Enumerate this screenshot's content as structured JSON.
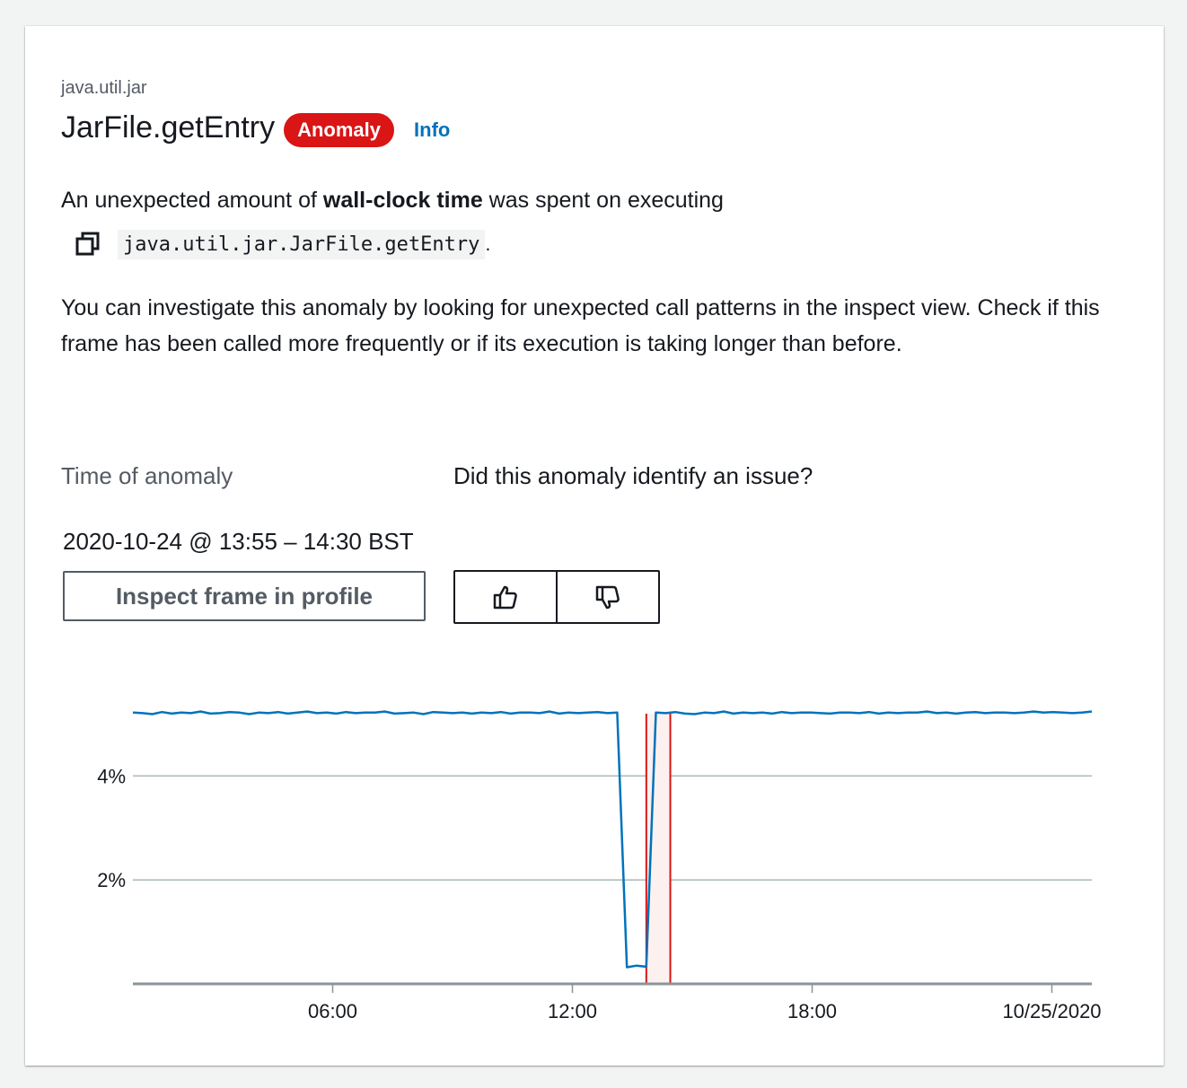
{
  "header": {
    "package": "java.util.jar",
    "title": "JarFile.getEntry",
    "badge": "Anomaly",
    "info_link": "Info"
  },
  "description": {
    "prefix": "An unexpected amount of ",
    "bold": "wall-clock time",
    "suffix": " was spent on executing",
    "code": "java.util.jar.JarFile.getEntry",
    "code_suffix": ".",
    "copy_icon": "copy-icon"
  },
  "guidance": "You can investigate this anomaly by looking for unexpected call patterns in the inspect view. Check if this frame has been called more frequently or if its execution is taking longer than before.",
  "time_of_anomaly": {
    "label": "Time of anomaly",
    "value": "2020-10-24 @ 13:55 – 14:30 BST"
  },
  "feedback": {
    "label": "Did this anomaly identify an issue?",
    "thumbs_up_icon": "thumbs-up-icon",
    "thumbs_down_icon": "thumbs-down-icon"
  },
  "actions": {
    "inspect_label": "Inspect frame in profile"
  },
  "colors": {
    "badge": "#d91515",
    "link": "#0073bb",
    "series": "#0073bb",
    "anomaly_band": "#d91515"
  },
  "chart_data": {
    "type": "line",
    "x_range_hours": [
      0,
      24
    ],
    "x_ticks": [
      {
        "hour": 5,
        "label": "06:00"
      },
      {
        "hour": 11,
        "label": "12:00"
      },
      {
        "hour": 17,
        "label": "18:00"
      },
      {
        "hour": 23,
        "label": "10/25/2020"
      }
    ],
    "y_ticks": [
      {
        "value": 4,
        "label": "4%"
      },
      {
        "value": 2,
        "label": "2%"
      }
    ],
    "ylim": [
      0,
      5.7
    ],
    "grid": true,
    "anomaly_window_hours": [
      12.85,
      13.45
    ],
    "series": [
      {
        "values_by_half_hour": [
          5.22,
          5.21,
          5.19,
          5.23,
          5.2,
          5.22,
          5.21,
          5.24,
          5.2,
          5.21,
          5.23,
          5.22,
          5.19,
          5.22,
          5.21,
          5.23,
          5.2,
          5.22,
          5.24,
          5.21,
          5.22,
          5.2,
          5.23,
          5.21,
          5.22,
          5.22,
          5.24,
          5.2,
          5.21,
          5.22,
          5.19,
          5.23,
          5.22,
          5.21,
          5.22,
          5.2,
          5.22,
          5.21,
          5.23,
          5.2,
          5.22,
          5.22,
          5.21,
          5.24,
          5.2,
          5.22,
          5.21,
          5.22,
          5.23,
          5.21,
          5.22,
          0.32,
          0.35,
          0.33,
          5.22,
          5.21,
          5.23,
          5.2,
          5.19,
          5.22,
          5.21,
          5.24,
          5.2,
          5.22,
          5.21,
          5.22,
          5.2,
          5.23,
          5.21,
          5.22,
          5.22,
          5.21,
          5.2,
          5.22,
          5.22,
          5.21,
          5.23,
          5.2,
          5.22,
          5.21,
          5.22,
          5.22,
          5.24,
          5.21,
          5.22,
          5.2,
          5.22,
          5.23,
          5.21,
          5.22,
          5.22,
          5.21,
          5.22,
          5.24,
          5.22,
          5.23,
          5.22,
          5.21,
          5.22,
          5.24
        ]
      }
    ]
  }
}
